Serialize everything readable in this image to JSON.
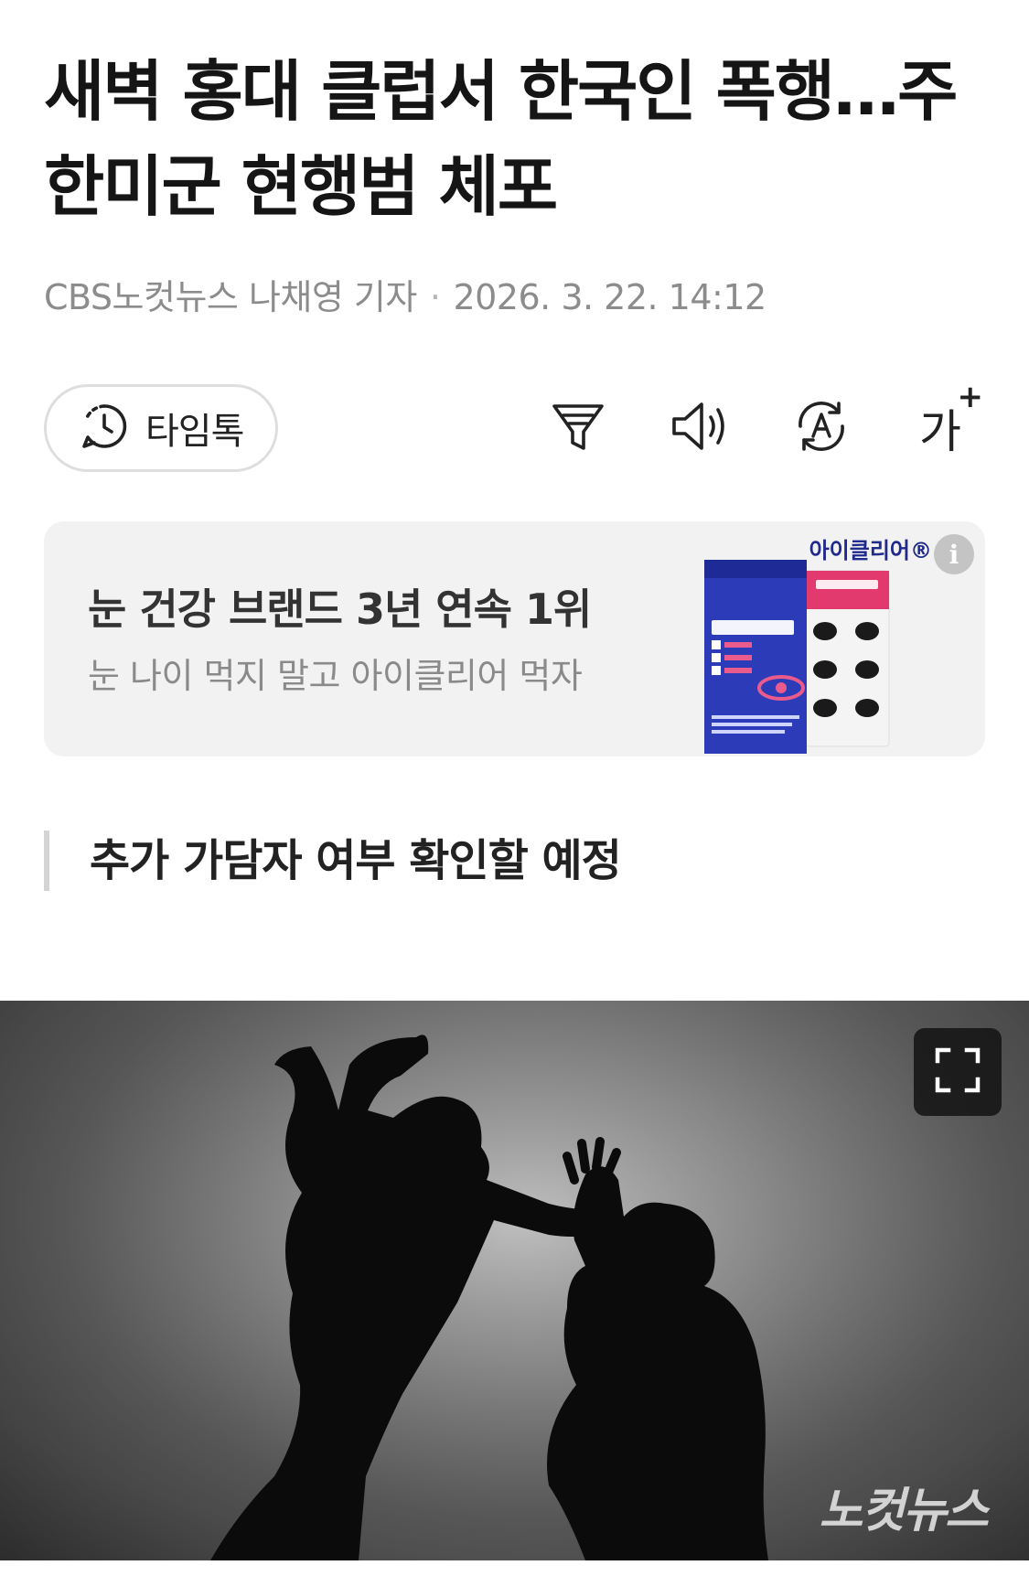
{
  "article": {
    "headline": "새벽 홍대 클럽서 한국인 폭행…주한미군 현행범 체포",
    "byline": {
      "author": "CBS노컷뉴스 나채영 기자",
      "separator": "·",
      "date": "2026. 3. 22. 14:12"
    },
    "subheading": "추가 가담자 여부 확인할 예정"
  },
  "toolbar": {
    "timetalk_label": "타임톡",
    "font_size_label": "가",
    "font_size_plus": "+",
    "icons": [
      "clock-chat-icon",
      "filter-icon",
      "speaker-icon",
      "translate-icon",
      "font-size-icon"
    ]
  },
  "ad": {
    "title": "눈 건강 브랜드 3년 연속 1위",
    "subtitle": "눈 나이 먹지 말고 아이클리어 먹자",
    "brand": "아이클리어®",
    "info_icon": "i",
    "colors": {
      "box_blue": "#2c3bb8",
      "box_pink": "#e23a6e"
    }
  },
  "photo": {
    "watermark": "노컷뉴스",
    "expand_icon": "fullscreen-icon"
  }
}
